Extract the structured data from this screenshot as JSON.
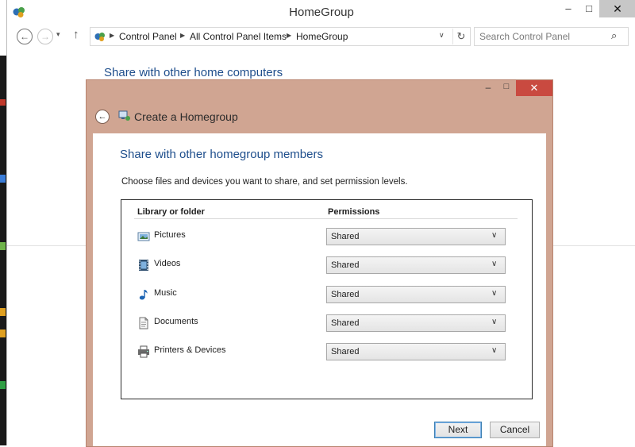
{
  "window": {
    "title": "HomeGroup",
    "minimize_glyph": "–",
    "maximize_glyph": "□",
    "close_glyph": "✕",
    "icon": "homegroup-icon"
  },
  "address_bar": {
    "back_glyph": "←",
    "forward_glyph": "→",
    "recent_glyph": "▾",
    "up_glyph": "↑",
    "breadcrumbs": [
      "Control Panel",
      "All Control Panel Items",
      "HomeGroup"
    ],
    "crumb_separator": "▶",
    "dropdown_glyph": "∨",
    "refresh_glyph": "↻"
  },
  "search": {
    "placeholder": "Search Control Panel",
    "icon_glyph": "⌕"
  },
  "background": {
    "heading": "Share with other home computers"
  },
  "dialog": {
    "title": "Create a Homegroup",
    "back_glyph": "←",
    "minimize_glyph": "–",
    "maximize_glyph": "□",
    "close_glyph": "✕",
    "accent_color": "#d0a592",
    "close_color": "#c94a40",
    "heading": "Share with other homegroup members",
    "instruction": "Choose files and devices you want to share, and set permission levels.",
    "table": {
      "col_library": "Library or folder",
      "col_permissions": "Permissions",
      "rows": [
        {
          "label": "Pictures",
          "icon": "pictures-icon",
          "permission": "Shared"
        },
        {
          "label": "Videos",
          "icon": "videos-icon",
          "permission": "Shared"
        },
        {
          "label": "Music",
          "icon": "music-icon",
          "permission": "Shared"
        },
        {
          "label": "Documents",
          "icon": "documents-icon",
          "permission": "Shared"
        },
        {
          "label": "Printers & Devices",
          "icon": "printer-icon",
          "permission": "Shared"
        }
      ],
      "select_arrow": "∨"
    },
    "next_label": "Next",
    "cancel_label": "Cancel"
  }
}
